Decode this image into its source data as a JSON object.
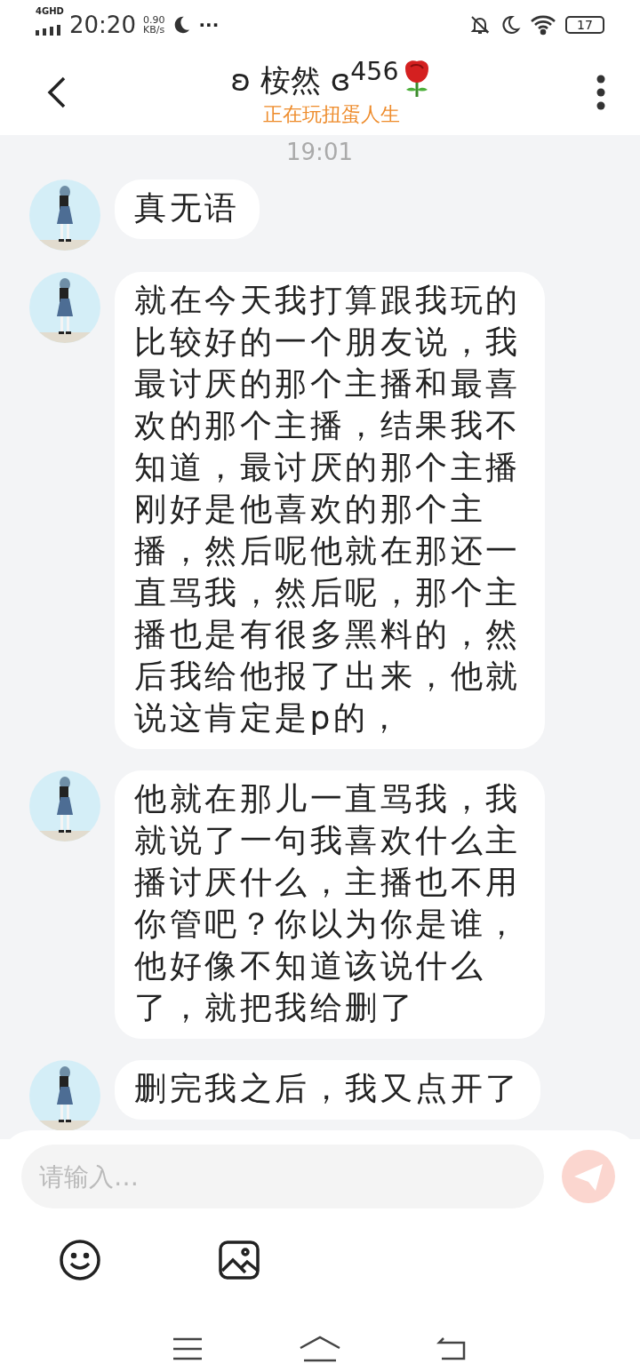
{
  "status_bar": {
    "network": "4GHD",
    "time": "20:20",
    "speed_value": "0.90",
    "speed_unit": "KB/s",
    "more": "···",
    "battery": "17"
  },
  "header": {
    "title": "ʚ 桉然 ɞ$^{456}$",
    "subtitle": "正在玩扭蛋人生"
  },
  "chat": {
    "time": "19:01",
    "messages": [
      {
        "text": "真无语"
      },
      {
        "text": "就在今天我打算跟我玩的比较好的一个朋友说，我最讨厌的那个主播和最喜欢的那个主播，结果我不知道，最讨厌的那个主播刚好是他喜欢的那个主播，然后呢他就在那还一直骂我，然后呢，那个主播也是有很多黑料的，然后我给他报了出来，他就说这肯定是p的，"
      },
      {
        "text": "他就在那儿一直骂我，我就说了一句我喜欢什么主播讨厌什么，主播也不用你管吧？你以为你是谁，他好像不知道该说什么了，就把我给删了"
      },
      {
        "text": "删完我之后，我又点开了"
      }
    ]
  },
  "composer": {
    "placeholder": "请输入…"
  }
}
